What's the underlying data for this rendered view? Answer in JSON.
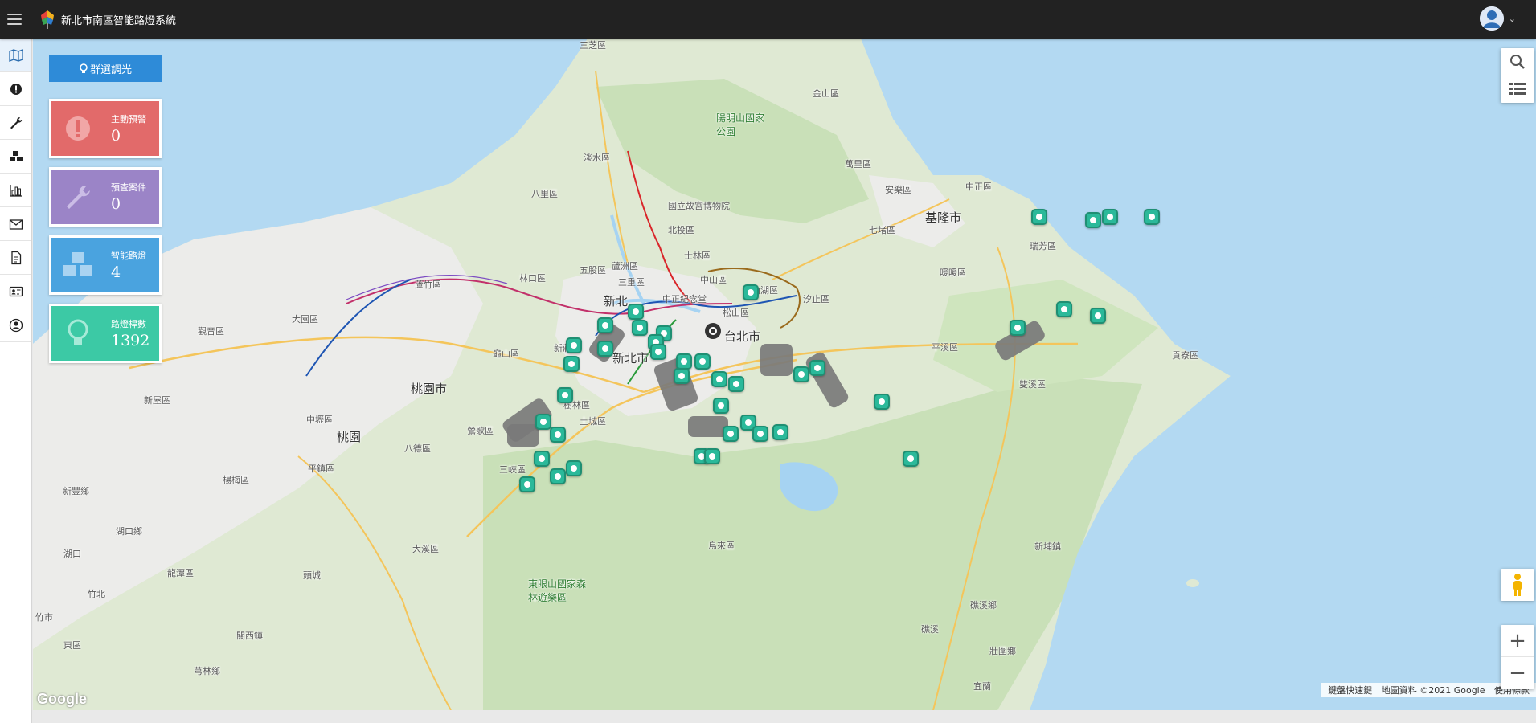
{
  "header": {
    "title": "新北市南區智能路燈系統"
  },
  "sidebar": {
    "items": [
      {
        "name": "map",
        "icon": "map-icon"
      },
      {
        "name": "alerts",
        "icon": "exclamation-icon"
      },
      {
        "name": "maintenance",
        "icon": "wrench-icon"
      },
      {
        "name": "devices",
        "icon": "cubes-icon"
      },
      {
        "name": "reports",
        "icon": "bar-chart-icon"
      },
      {
        "name": "messages",
        "icon": "envelope-icon"
      },
      {
        "name": "documents",
        "icon": "document-icon"
      },
      {
        "name": "contacts",
        "icon": "id-card-icon"
      },
      {
        "name": "account",
        "icon": "user-circle-icon"
      }
    ]
  },
  "panel": {
    "dim_button": "群選調光",
    "cards": [
      {
        "label": "主動預警",
        "value": "0",
        "color": "#e26a6a",
        "icon": "exclamation-icon"
      },
      {
        "label": "預查案件",
        "value": "0",
        "color": "#9b84c7",
        "icon": "wrench-icon"
      },
      {
        "label": "智能路燈",
        "value": "4",
        "color": "#4aa3df",
        "icon": "cubes-icon"
      },
      {
        "label": "路燈桿數",
        "value": "1392",
        "color": "#3cc9a5",
        "icon": "lightbulb-icon"
      }
    ]
  },
  "map": {
    "places": [
      {
        "text": "三芝區",
        "cls": ""
      },
      {
        "text": "金山區",
        "cls": ""
      },
      {
        "text": "陽明山國家公園",
        "cls": "park"
      },
      {
        "text": "淡水區",
        "cls": ""
      },
      {
        "text": "萬里區",
        "cls": ""
      },
      {
        "text": "八里區",
        "cls": ""
      },
      {
        "text": "安樂區",
        "cls": ""
      },
      {
        "text": "中正區",
        "cls": ""
      },
      {
        "text": "基隆市",
        "cls": "city"
      },
      {
        "text": "國立故宮博物院",
        "cls": ""
      },
      {
        "text": "北投區",
        "cls": ""
      },
      {
        "text": "七堵區",
        "cls": ""
      },
      {
        "text": "瑞芳區",
        "cls": ""
      },
      {
        "text": "士林區",
        "cls": ""
      },
      {
        "text": "五股區",
        "cls": ""
      },
      {
        "text": "蘆洲區",
        "cls": ""
      },
      {
        "text": "林口區",
        "cls": ""
      },
      {
        "text": "三重區",
        "cls": ""
      },
      {
        "text": "中山區",
        "cls": ""
      },
      {
        "text": "暖暖區",
        "cls": ""
      },
      {
        "text": "蘆竹區",
        "cls": ""
      },
      {
        "text": "新北",
        "cls": "city"
      },
      {
        "text": "中正紀念堂",
        "cls": ""
      },
      {
        "text": "內湖區",
        "cls": ""
      },
      {
        "text": "汐止區",
        "cls": ""
      },
      {
        "text": "大園區",
        "cls": ""
      },
      {
        "text": "觀音區",
        "cls": ""
      },
      {
        "text": "松山區",
        "cls": ""
      },
      {
        "text": "台北市",
        "cls": "city"
      },
      {
        "text": "新莊區",
        "cls": ""
      },
      {
        "text": "平溪區",
        "cls": ""
      },
      {
        "text": "新北市",
        "cls": "city"
      },
      {
        "text": "龜山區",
        "cls": ""
      },
      {
        "text": "桃園市",
        "cls": "city"
      },
      {
        "text": "樹林區",
        "cls": ""
      },
      {
        "text": "雙溪區",
        "cls": ""
      },
      {
        "text": "貢寮區",
        "cls": ""
      },
      {
        "text": "新屋區",
        "cls": ""
      },
      {
        "text": "中壢區",
        "cls": ""
      },
      {
        "text": "鶯歌區",
        "cls": ""
      },
      {
        "text": "土城區",
        "cls": ""
      },
      {
        "text": "桃園",
        "cls": "city"
      },
      {
        "text": "八德區",
        "cls": ""
      },
      {
        "text": "三峽區",
        "cls": ""
      },
      {
        "text": "楊梅區",
        "cls": ""
      },
      {
        "text": "平鎮區",
        "cls": ""
      },
      {
        "text": "新豐鄉",
        "cls": ""
      },
      {
        "text": "湖口鄉",
        "cls": ""
      },
      {
        "text": "大溪區",
        "cls": ""
      },
      {
        "text": "烏來區",
        "cls": ""
      },
      {
        "text": "湖口",
        "cls": ""
      },
      {
        "text": "新埔鎮",
        "cls": ""
      },
      {
        "text": "龍潭區",
        "cls": ""
      },
      {
        "text": "頭城",
        "cls": ""
      },
      {
        "text": "東眼山國家森林遊樂區",
        "cls": "park"
      },
      {
        "text": "竹北",
        "cls": ""
      },
      {
        "text": "竹市",
        "cls": ""
      },
      {
        "text": "關西鎮",
        "cls": ""
      },
      {
        "text": "礁溪",
        "cls": ""
      },
      {
        "text": "礁溪鄉",
        "cls": ""
      },
      {
        "text": "東區",
        "cls": ""
      },
      {
        "text": "壯圍鄉",
        "cls": ""
      },
      {
        "text": "芎林鄉",
        "cls": ""
      },
      {
        "text": "宜蘭",
        "cls": ""
      }
    ]
  },
  "controls": {
    "search_icon": "search-icon",
    "list_icon": "list-icon",
    "zoom_in": "+",
    "zoom_out": "−"
  },
  "attribution": {
    "shortcuts": "鍵盤快速鍵",
    "data": "地圖資料 ©2021 Google",
    "terms": "使用條款",
    "google": "Google"
  }
}
